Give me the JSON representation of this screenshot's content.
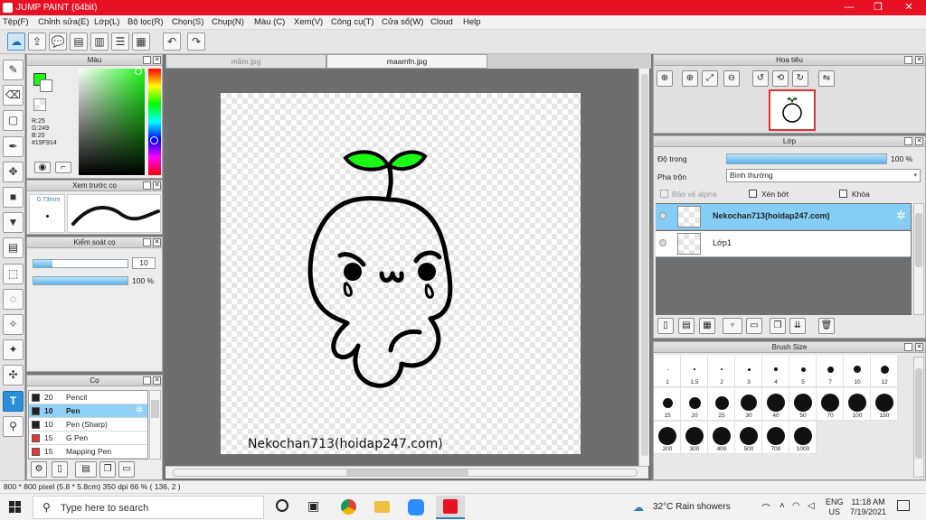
{
  "app": {
    "title": "JUMP PAINT (64bit)"
  },
  "window_controls": {
    "minimize": "—",
    "maximize": "❐",
    "close": "✕"
  },
  "menu": [
    "Tệp(F)",
    "Chỉnh sửa(E)",
    "Lớp(L)",
    "Bộ lọc(R)",
    "Chọn(S)",
    "Chụp(N)",
    "Màu (C)",
    "Xem(V)",
    "Công cụ(T)",
    "Cửa sổ(W)",
    "Cloud",
    "Help"
  ],
  "toolbar": {
    "icons": [
      "cloud-icon",
      "share-icon",
      "comment-icon",
      "message-icon",
      "page-icon",
      "list-icon",
      "grid-icon",
      "undo-icon",
      "redo-icon"
    ],
    "glyphs": [
      "☁",
      "⇪",
      "💬",
      "▤",
      "▥",
      "☰",
      "▦",
      "↶",
      "↷"
    ]
  },
  "tools": {
    "glyphs": [
      "✎",
      "⌫",
      "▢",
      "✒",
      "✥",
      "■",
      "▼",
      "▤",
      "⬚",
      "◌",
      "✧",
      "✦",
      "✣",
      "T",
      "⚲"
    ],
    "names": [
      "brush-tool",
      "eraser-tool",
      "rectangle-tool",
      "pen-tool",
      "move-tool",
      "fill-rect-tool",
      "bucket-tool",
      "gradient-tool",
      "rect-select-tool",
      "lasso-tool",
      "magic-wand-tool",
      "select-pen-tool",
      "select-eraser-tool",
      "text-tool",
      "eyedropper-tool"
    ],
    "selected": 13
  },
  "color_panel": {
    "title": "Màu",
    "foreground": "#19F914",
    "r": "R:25",
    "g": "G:249",
    "b": "B:20",
    "hex": "#19F914"
  },
  "brush_preview": {
    "title": "Xem trước cọ",
    "size": "0.73mm"
  },
  "brush_control": {
    "title": "Kiểm soát cọ",
    "size_value": "10",
    "opacity_fill": 1.0,
    "size_fill": 0.2,
    "opacity_label": "100 %"
  },
  "brush_list": {
    "title": "Cọ",
    "items": [
      {
        "size": "20",
        "name": "Pencil",
        "color": "#222222"
      },
      {
        "size": "10",
        "name": "Pen",
        "color": "#222222"
      },
      {
        "size": "10",
        "name": "Pen (Sharp)",
        "color": "#222222"
      },
      {
        "size": "15",
        "name": "G Pen",
        "color": "#e53935"
      },
      {
        "size": "15",
        "name": "Mapping Pen",
        "color": "#e53935"
      }
    ],
    "selected": 1
  },
  "documents": {
    "tabs": [
      "mầm.jpg",
      "maamfn.jpg"
    ],
    "active": 1
  },
  "canvas": {
    "watermark": "Nekochan713(hoidap247.com)"
  },
  "navigator": {
    "title": "Hoa tiêu"
  },
  "layers": {
    "title": "Lớp",
    "opacity_label": "Độ trong",
    "opacity_value": "100 %",
    "opacity": 1.0,
    "blend_label": "Pha trộn",
    "blend_value": "Bình thường",
    "protect_alpha": "Bảo vệ alpha",
    "clip": "Xén bớt",
    "lock": "Khóa",
    "items": [
      {
        "name": "Nekochan713(hoidap247.com)",
        "selected": true
      },
      {
        "name": "Lớp1",
        "selected": false
      }
    ]
  },
  "brush_size": {
    "title": "Brush Size",
    "sizes": [
      "1",
      "1.5",
      "2",
      "3",
      "4",
      "5",
      "7",
      "10",
      "12",
      "15",
      "20",
      "25",
      "30",
      "40",
      "50",
      "70",
      "100",
      "150",
      "200",
      "300",
      "400",
      "500",
      "700",
      "1000"
    ]
  },
  "status": {
    "text": "800 * 800 pixel  (5.8 * 5.8cm)  350 dpi  66 %  ( 136, 2 )"
  },
  "taskbar": {
    "search_placeholder": "Type here to search",
    "weather": "32°C  Rain showers",
    "lang_top": "ENG",
    "lang_bottom": "US",
    "time": "11:18 AM",
    "date": "7/19/2021"
  }
}
